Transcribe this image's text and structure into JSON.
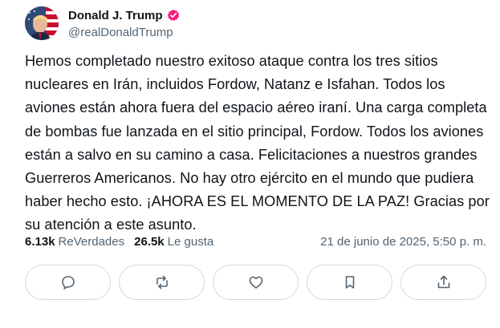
{
  "author": {
    "display_name": "Donald J. Trump",
    "handle": "@realDonaldTrump",
    "avatar_icon": "profile-photo",
    "verified_icon": "verified-badge-icon",
    "verified_color": "#f91880"
  },
  "tweet": {
    "text": "Hemos completado nuestro exitoso ataque contra los tres sitios nucleares en Irán, incluidos Fordow, Natanz e Isfahan. Todos los aviones están ahora fuera del espacio aéreo iraní. Una carga completa de bombas fue lanzada en el sitio principal, Fordow. Todos los aviones están a salvo en su camino a casa. Felicitaciones a nuestros grandes Guerreros Americanos. No hay otro ejército en el mundo que pudiera haber hecho esto. ¡AHORA ES EL MOMENTO DE LA PAZ! Gracias por su atención a este asunto."
  },
  "stats": {
    "retweets_count": "6.13k",
    "retweets_label": "ReVerdades",
    "likes_count": "26.5k",
    "likes_label": "Le gusta",
    "timestamp": "21 de junio de 2025, 5:50 p. m."
  },
  "actions": [
    {
      "icon": "reply-icon"
    },
    {
      "icon": "retweet-icon"
    },
    {
      "icon": "heart-icon"
    },
    {
      "icon": "bookmark-icon"
    },
    {
      "icon": "share-icon"
    }
  ],
  "colors": {
    "text": "#0f1419",
    "secondary": "#536471",
    "border": "#cfd9de"
  }
}
